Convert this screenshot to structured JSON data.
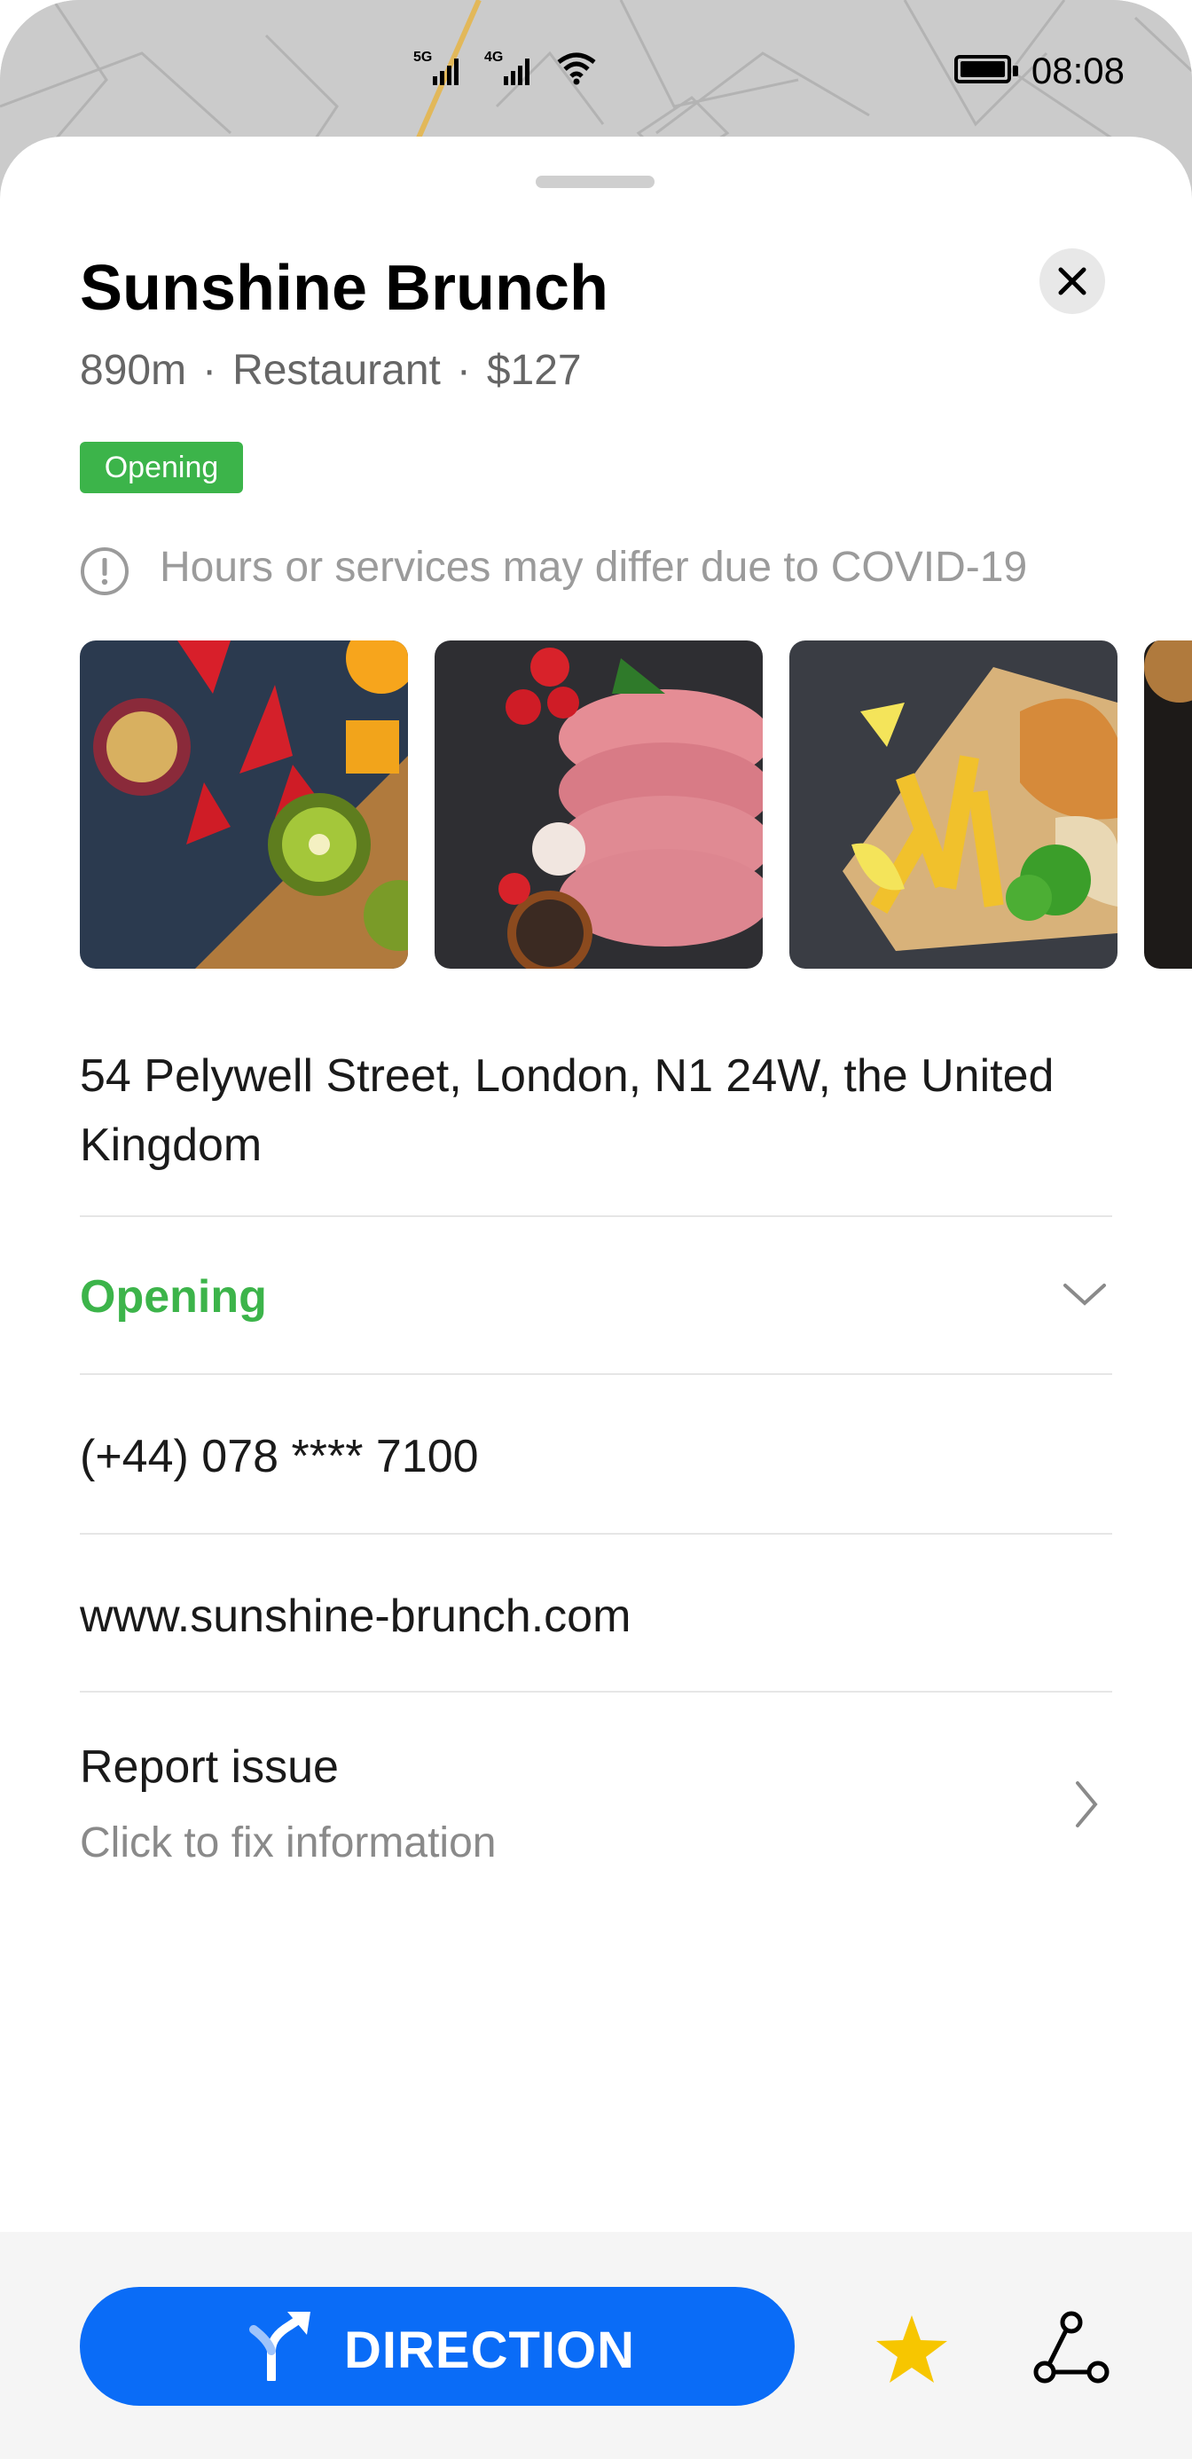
{
  "status_bar": {
    "signal1_label": "5G",
    "signal2_label": "4G",
    "time": "08:08"
  },
  "place": {
    "name": "Sunshine Brunch",
    "distance": "890m",
    "category": "Restaurant",
    "price": "$127",
    "separator": "·",
    "badge": "Opening",
    "notice": "Hours or services may differ due to COVID-19"
  },
  "photos": [
    {
      "name": "fruit-photo"
    },
    {
      "name": "steak-photo"
    },
    {
      "name": "fish-and-chips-photo"
    },
    {
      "name": "dish-photo"
    }
  ],
  "details": {
    "address": "54 Pelywell Street, London, N1 24W, the United Kingdom",
    "hours_status": "Opening",
    "phone": "(+44) 078 **** 7100",
    "website": "www.sunshine-brunch.com",
    "report_title": "Report issue",
    "report_subtitle": "Click to fix information"
  },
  "actions": {
    "direction_label": "DIRECTION",
    "favorite_icon": "star-icon",
    "route_icon": "route-icon"
  },
  "colors": {
    "accent_blue": "#0a6cf7",
    "open_green": "#3cb44a",
    "star_yellow": "#f7c600"
  }
}
